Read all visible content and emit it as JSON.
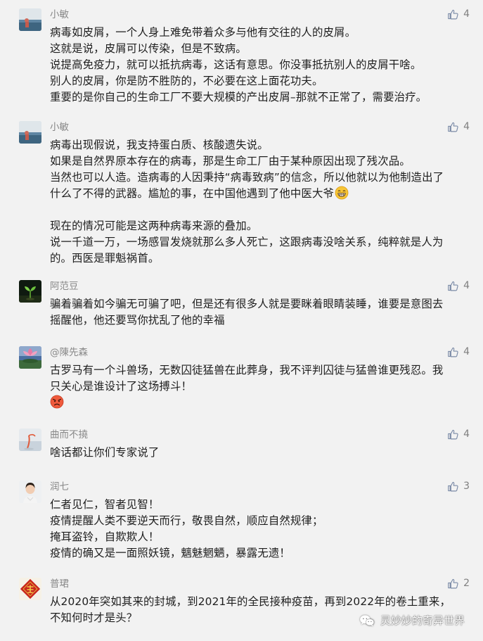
{
  "comments": [
    {
      "nickname": "小敏",
      "likes": "4",
      "lines": [
        "病毒如皮屑，一个人身上难免带着众多与他有交往的人的皮屑。",
        "这就是说，皮屑可以传染，但是不致病。",
        "说提高免疫力，就可以抵抗病毒，这话有意思。你没事抵抗别人的皮屑干啥。",
        "别人的皮屑，你是防不胜防的，不必要在这上面花功夫。",
        "重要的是你自己的生命工厂不要大规模的产出皮屑–那就不正常了，需要治疗。"
      ]
    },
    {
      "nickname": "小敏",
      "likes": "4",
      "lines": [
        "病毒出现假说，我支持蛋白质、核酸遗失说。",
        "如果是自然界原本存在的病毒，那是生命工厂由于某种原因出现了残次品。",
        "当然也可以人造。造病毒的人因秉持“病毒致病”的信念，所以他就以为他制造出了",
        "什么了不得的武器。尴尬的事，在中国他遇到了他中医大爷",
        "",
        "现在的情况可能是这两种病毒来源的叠加。",
        "说一千道一万，一场感冒发烧就那么多人死亡，这跟病毒没啥关系，纯粹就是人为",
        "的。西医是罪魁祸首。"
      ]
    },
    {
      "nickname": "阿范豆",
      "likes": "4",
      "lines": [
        "骗着骗着如今骗无可骗了吧，但是还有很多人就是要眯着眼睛装睡，谁要是意图去",
        "摇醒他，他还要骂你扰乱了他的幸福"
      ]
    },
    {
      "nickname": "@陳先森",
      "likes": "4",
      "lines": [
        "古罗马有一个斗兽场，无数囚徒猛兽在此葬身，我不评判囚徒与猛兽谁更残忍。我",
        "只关心是谁设计了这场搏斗！"
      ]
    },
    {
      "nickname": "曲而不撓",
      "likes": "4",
      "lines": [
        "啥话都让你们专家说了"
      ]
    },
    {
      "nickname": "润七",
      "likes": "3",
      "lines": [
        "仁者见仁，智者见智！",
        "疫情提醒人类不要逆天而行，敬畏自然，顺应自然规律；",
        "掩耳盗铃，自欺欺人！",
        "疫情的确又是一面照妖镜，魑魅魍魉，暴露无遗！"
      ]
    },
    {
      "nickname": "普珺",
      "likes": "2",
      "lines": [
        "从2020年突如其来的封城，到2021年的全民接种疫苗，再到2022年的卷土重来，",
        "不知何时才是头？"
      ]
    }
  ],
  "watermark": {
    "text": "灵妙妙的奇异世界",
    "icon": "wechat-icon"
  },
  "icons": {
    "like": "thumbs-up-icon",
    "grin": "grin-emoji",
    "angry": "angry-emoji"
  },
  "colors": {
    "background": "#f2f2f2",
    "text": "#1e1e1e",
    "nickname": "#888888",
    "like_icon": "#7a8aa6"
  }
}
